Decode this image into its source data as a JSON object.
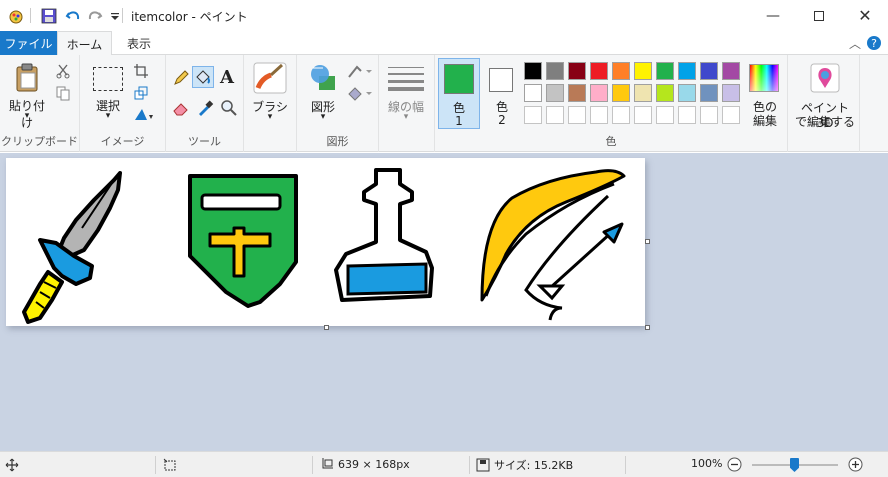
{
  "window": {
    "title": "itemcolor - ペイント"
  },
  "menu": {
    "file": "ファイル",
    "home": "ホーム",
    "view": "表示"
  },
  "groups": {
    "clipboard": {
      "label": "クリップボード",
      "paste": "貼り付け"
    },
    "image": {
      "label": "イメージ",
      "select": "選択"
    },
    "tools": {
      "label": "ツール"
    },
    "shapes": {
      "label": "図形",
      "brush": "ブラシ",
      "shapes": "図形",
      "size": "線の幅"
    },
    "colors": {
      "label": "色",
      "color1": "色\n1",
      "color1_line1": "色",
      "color1_line2": "1",
      "color2_line1": "色",
      "color2_line2": "2",
      "edit_line1": "色の",
      "edit_line2": "編集"
    },
    "paint3d": {
      "line1": "ペイント 3D",
      "line2": "で編集する"
    }
  },
  "colors": {
    "color1": "#22b14c",
    "color2": "#ffffff",
    "palette_row1": [
      "#000000",
      "#7f7f7f",
      "#880015",
      "#ed1c24",
      "#ff7f27",
      "#fff200",
      "#22b14c",
      "#00a2e8",
      "#3f48cc",
      "#a349a4"
    ],
    "palette_row2": [
      "#ffffff",
      "#c3c3c3",
      "#b97a57",
      "#ffaec9",
      "#ffc90e",
      "#efe4b0",
      "#b5e61d",
      "#99d9ea",
      "#7092be",
      "#c8bfe7"
    ],
    "palette_row3_count": 10
  },
  "status": {
    "size": "639 × 168px",
    "filesize": "サイズ: 15.2KB",
    "zoom": "100%"
  }
}
